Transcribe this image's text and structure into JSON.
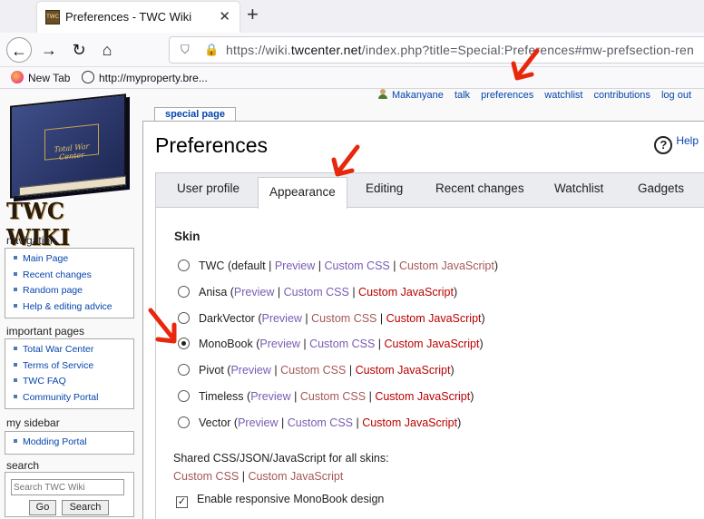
{
  "browser": {
    "tab_title": "Preferences - TWC Wiki",
    "favicon_text": "TWC",
    "url_prefix": "https://wiki.",
    "url_domain": "twcenter.net",
    "url_suffix": "/index.php?title=Special:Preferences#mw-prefsection-ren",
    "bookmarks": [
      "New Tab",
      "http://myproperty.bre..."
    ]
  },
  "personal_links": {
    "user": "Makanyane",
    "talk": "talk",
    "preferences": "preferences",
    "watchlist": "watchlist",
    "contributions": "contributions",
    "logout": "log out"
  },
  "logo": {
    "text": "TWC WIKI",
    "book_text": "Total War Center"
  },
  "sidebar": {
    "navigation": {
      "title": "navigation",
      "items": [
        "Main Page",
        "Recent changes",
        "Random page",
        "Help & editing advice"
      ]
    },
    "important": {
      "title": "important pages",
      "items": [
        "Total War Center",
        "Terms of Service",
        "TWC FAQ",
        "Community Portal"
      ]
    },
    "mysidebar": {
      "title": "my sidebar",
      "items": [
        "Modding Portal"
      ]
    },
    "search": {
      "title": "search",
      "placeholder": "Search TWC Wiki",
      "go": "Go",
      "search": "Search"
    }
  },
  "page": {
    "tab_label": "special page",
    "heading": "Preferences",
    "help": "Help",
    "tabs": [
      "User profile",
      "Appearance",
      "Editing",
      "Recent changes",
      "Watchlist",
      "Gadgets"
    ],
    "active_tab": "Appearance",
    "skin_title": "Skin",
    "skins": [
      {
        "name": "TWC",
        "suffix": " (default | ",
        "preview": "Preview",
        "css": "Custom CSS",
        "js": "Custom JavaScript",
        "selected": false
      },
      {
        "name": "Anisa",
        "suffix": " (",
        "preview": "Preview",
        "css": "Custom CSS",
        "js": "Custom JavaScript",
        "selected": false
      },
      {
        "name": "DarkVector",
        "suffix": " (",
        "preview": "Preview",
        "css": "Custom CSS",
        "js": "Custom JavaScript",
        "selected": false
      },
      {
        "name": "MonoBook",
        "suffix": " (",
        "preview": "Preview",
        "css": "Custom CSS",
        "js": "Custom JavaScript",
        "selected": true
      },
      {
        "name": "Pivot",
        "suffix": " (",
        "preview": "Preview",
        "css": "Custom CSS",
        "js": "Custom JavaScript",
        "selected": false
      },
      {
        "name": "Timeless",
        "suffix": " (",
        "preview": "Preview",
        "css": "Custom CSS",
        "js": "Custom JavaScript",
        "selected": false
      },
      {
        "name": "Vector",
        "suffix": " (",
        "preview": "Preview",
        "css": "Custom CSS",
        "js": "Custom JavaScript",
        "selected": false
      }
    ],
    "shared_label": "Shared CSS/JSON/JavaScript for all skins:",
    "shared_css": "Custom CSS",
    "shared_js": "Custom JavaScript",
    "responsive_label": "Enable responsive MonoBook design",
    "responsive_checked": true
  },
  "colors": {
    "link": "#3366cc",
    "visited": "#795cb2",
    "redlink": "#ba0000",
    "arrow": "#e8280c"
  }
}
